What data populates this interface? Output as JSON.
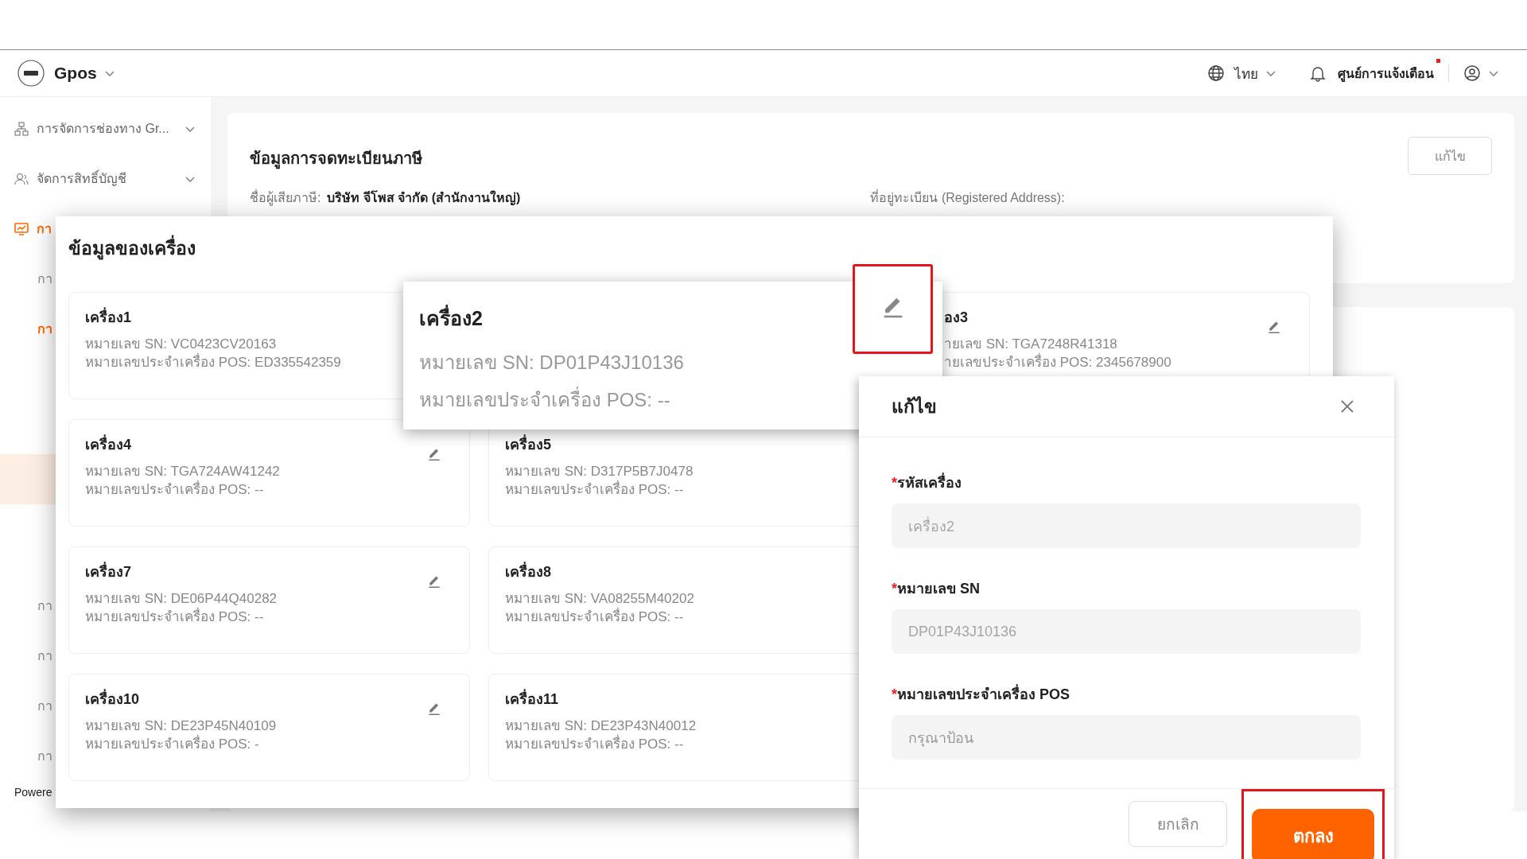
{
  "header": {
    "brand": "Gpos",
    "language": "ไทย",
    "notifications": "ศูนย์การแจ้งเตือน",
    "unread": true
  },
  "sidebar": {
    "items": [
      {
        "label": "การจัดการช่องทาง Gr...",
        "active": false,
        "expandable": true
      },
      {
        "label": "จัดการสิทธิ์บัญชี",
        "active": false,
        "expandable": true
      },
      {
        "label": "กา",
        "active": true,
        "expandable": false
      }
    ],
    "sub_items": [
      {
        "label": "กา",
        "active": false,
        "selected": false
      },
      {
        "label": "กา",
        "active": true,
        "selected": false
      },
      {
        "selected": true
      },
      {
        "label": "กา",
        "active": false,
        "selected": false
      },
      {
        "label": "กา",
        "active": false,
        "selected": false
      },
      {
        "label": "กา",
        "active": false,
        "selected": false
      },
      {
        "label": "กา",
        "active": false,
        "selected": false
      }
    ],
    "footer": "Powere"
  },
  "tax_card": {
    "title": "ข้อมูลการจดทะเบียนภาษี",
    "edit_button": "แก้ไข",
    "taxpayer_label": "ชื่อผู้เสียภาษี:",
    "taxpayer": "บริษัท จีโพส จำกัด (สำนักงานใหญ่)",
    "address_label": "ที่อยู่ทะเบียน (Registered Address):"
  },
  "device_panel": {
    "title": "ข้อมูลของเครื่อง",
    "cards": [
      {
        "title": "เครื่อง1",
        "sn_line": "หมายเลข SN:  VC0423CV20163",
        "pos_line": "หมายเลขประจำเครื่อง POS:  ED335542359",
        "edit_icon": false
      },
      {
        "kind": "hidden"
      },
      {
        "kind": "cut",
        "title": "อง3",
        "sn_line": "ายเลข SN:  TGA7248R41318",
        "pos_line": "ายเลขประจำเครื่อง POS:  2345678900",
        "edit_icon": true
      },
      {
        "title": "เครื่อง4",
        "sn_line": "หมายเลข SN:  TGA724AW41242",
        "pos_line": "หมายเลขประจำเครื่อง POS:  --",
        "edit_icon": true
      },
      {
        "title": "เครื่อง5",
        "sn_line": "หมายเลข SN:  D317P5B7J0478",
        "pos_line": "หมายเลขประจำเครื่อง POS:  --",
        "edit_icon": false
      },
      {
        "kind": "hidden"
      },
      {
        "title": "เครื่อง7",
        "sn_line": "หมายเลข SN:  DE06P44Q40282",
        "pos_line": "หมายเลขประจำเครื่อง POS:  --",
        "edit_icon": true
      },
      {
        "title": "เครื่อง8",
        "sn_line": "หมายเลข SN:  VA08255M40202",
        "pos_line": "หมายเลขประจำเครื่อง POS:  --",
        "edit_icon": false
      },
      {
        "kind": "hidden"
      },
      {
        "title": "เครื่อง10",
        "sn_line": "หมายเลข SN:  DE23P45N40109",
        "pos_line": "หมายเลขประจำเครื่อง POS:  -",
        "edit_icon": true
      },
      {
        "title": "เครื่อง11",
        "sn_line": "หมายเลข SN:  DE23P43N40012",
        "pos_line": "หมายเลขประจำเครื่อง POS:  --",
        "edit_icon": false
      }
    ]
  },
  "zoomed_card": {
    "title": "เครื่อง2",
    "sn_line": "หมายเลข SN:  DP01P43J10136",
    "pos_line": "หมายเลขประจำเครื่อง POS:  --",
    "edit_highlighted": true
  },
  "edit_dialog": {
    "title": "แก้ไข",
    "fields": [
      {
        "label": "รหัสเครื่อง",
        "required_mark": "*",
        "value": "เครื่อง2",
        "disabled": true
      },
      {
        "label": "หมายเลข SN",
        "required_mark": "*",
        "value": "DP01P43J10136",
        "disabled": true
      },
      {
        "label": "หมายเลขประจำเครื่อง POS",
        "required_mark": "*",
        "placeholder": "กรุณาป้อน",
        "disabled": false
      }
    ],
    "cancel": "ยกเลิก",
    "ok": "ตกลง",
    "ok_highlighted": true
  }
}
